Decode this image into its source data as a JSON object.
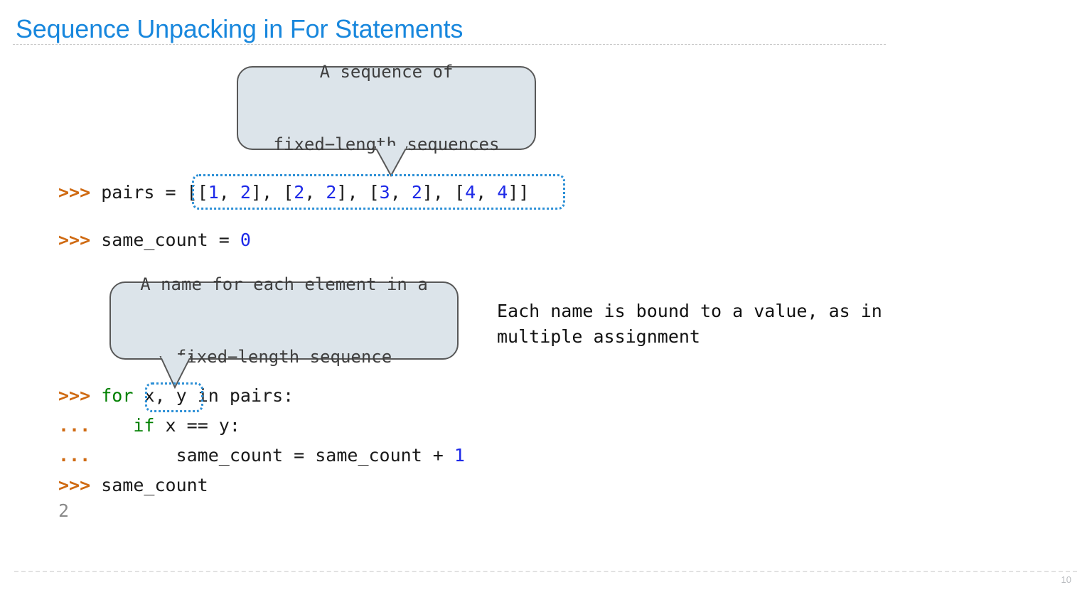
{
  "slide": {
    "title": "Sequence Unpacking in For Statements",
    "page_number": "10",
    "accent_color": "#1887dd",
    "prompt_color": "#cf6a12",
    "keyword_color": "#008000",
    "number_color": "#1d29e8",
    "output_color": "#8a8a8a",
    "callout_fill": "#dce4ea",
    "callout_border": "#585858",
    "highlight_color": "#2b8fd6"
  },
  "callouts": [
    {
      "id": "sequence-of-sequences",
      "line1": "A sequence of",
      "line2": "fixed−length sequences"
    },
    {
      "id": "name-per-element",
      "line1": "A name for each element in a",
      "line2": "fixed−length sequence"
    }
  ],
  "note": {
    "line1": "Each name is bound to a value, as in",
    "line2": "multiple assignment"
  },
  "code": {
    "line_pairs": {
      "prompt": ">>>",
      "before": " pairs = ",
      "tokens": [
        {
          "t": "[[",
          "k": "plain"
        },
        {
          "t": "1",
          "k": "num"
        },
        {
          "t": ", ",
          "k": "plain"
        },
        {
          "t": "2",
          "k": "num"
        },
        {
          "t": "], [",
          "k": "plain"
        },
        {
          "t": "2",
          "k": "num"
        },
        {
          "t": ", ",
          "k": "plain"
        },
        {
          "t": "2",
          "k": "num"
        },
        {
          "t": "], [",
          "k": "plain"
        },
        {
          "t": "3",
          "k": "num"
        },
        {
          "t": ", ",
          "k": "plain"
        },
        {
          "t": "2",
          "k": "num"
        },
        {
          "t": "], [",
          "k": "plain"
        },
        {
          "t": "4",
          "k": "num"
        },
        {
          "t": ", ",
          "k": "plain"
        },
        {
          "t": "4",
          "k": "num"
        },
        {
          "t": "]]",
          "k": "plain"
        }
      ],
      "full_text": ">>> pairs = [[1, 2], [2, 2], [3, 2], [4, 4]]"
    },
    "line_same_count_init": {
      "prompt": ">>>",
      "name": " same_count = ",
      "value": "0",
      "full_text": ">>> same_count = 0"
    },
    "line_for": {
      "prompt": ">>>",
      "kw": "for",
      "target": "x, y",
      "rest": " in pairs:",
      "full_text": ">>> for x, y in pairs:"
    },
    "line_if": {
      "prompt": "...",
      "indent": "    ",
      "kw": "if",
      "rest": " x == y:",
      "full_text": "...     if x == y:"
    },
    "line_increment": {
      "prompt": "...",
      "indent": "        ",
      "expr": "same_count = same_count + ",
      "value": "1",
      "full_text": "...         same_count = same_count + 1"
    },
    "line_query": {
      "prompt": ">>>",
      "expr": " same_count",
      "full_text": ">>> same_count"
    },
    "line_output": {
      "value": "2"
    }
  }
}
